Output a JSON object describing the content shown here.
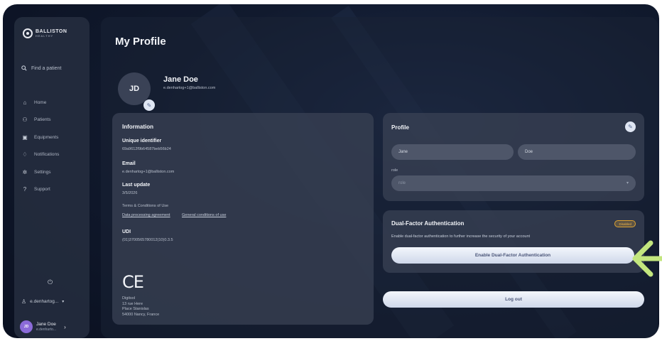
{
  "sidebar": {
    "logo_text": "BALLISTON",
    "logo_sub": "HEALTHY",
    "search_placeholder": "Find a patient",
    "items": [
      {
        "label": "Home"
      },
      {
        "label": "Patients"
      },
      {
        "label": "Equipments"
      },
      {
        "label": "Notifications"
      },
      {
        "label": "Settings"
      },
      {
        "label": "Support"
      }
    ],
    "user_menu_label": "e.denhartog...",
    "user_card": {
      "initials": "JD",
      "name": "Jane Doe",
      "email": "e.denharto..."
    }
  },
  "main": {
    "title": "My Profile",
    "avatar_initials": "JD",
    "name": "Jane Doe",
    "email": "e.denhartog+1@balliston.com"
  },
  "information": {
    "title": "Information",
    "uid_label": "Unique identifier",
    "uid_value": "69a9612f9b64587beb56b24",
    "email_label": "Email",
    "email_value": "e.denhartog+1@balliston.com",
    "update_label": "Last update",
    "update_value": "3/5/2026",
    "terms_label": "Terms & Conditions of Use",
    "link_dpa": "Data processing agreement",
    "link_gcu": "General conditions of use",
    "udi_label": "UDI",
    "udi_value": "(01)3700565780012(10)0.3.5",
    "ce": "CE",
    "address": [
      "Digitsol",
      "13 rue Here",
      "Place Stanislas",
      "54000 Nancy, France"
    ]
  },
  "profile_card": {
    "title": "Profile",
    "first_name": "Jane",
    "last_name": "Doe",
    "role_label": "role",
    "role_placeholder": "role"
  },
  "mfa": {
    "title": "Dual-Factor Authentication",
    "status": "Disabled",
    "description": "Enable dual-factor authentication to further increase the security of your account",
    "button": "Enable Dual-Factor Authentication"
  },
  "logout_label": "Log out",
  "colors": {
    "accent_arrow": "#c3e67e",
    "badge": "#e0a431",
    "avatar_small": "#8b6bd9"
  }
}
